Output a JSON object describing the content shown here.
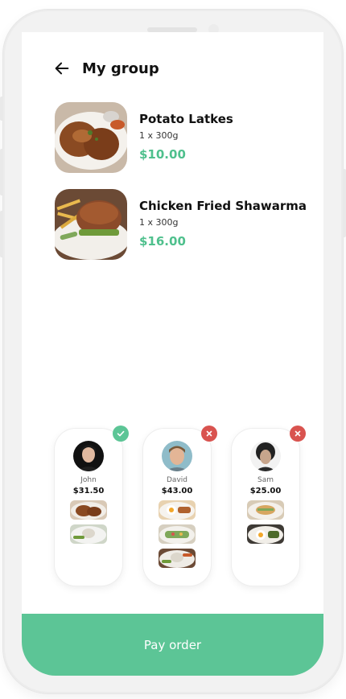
{
  "header": {
    "title": "My group"
  },
  "cart_items": [
    {
      "name": "Potato Latkes",
      "quantity": "1 x 300g",
      "price": "$10.00"
    },
    {
      "name": "Chicken Fried Shawarma",
      "quantity": "1 x 300g",
      "price": "$16.00"
    }
  ],
  "members": [
    {
      "name": "John",
      "total": "$31.50",
      "status": "paid"
    },
    {
      "name": "David",
      "total": "$43.00",
      "status": "unpaid"
    },
    {
      "name": "Sam",
      "total": "$25.00",
      "status": "unpaid"
    }
  ],
  "pay_button": {
    "label": "Pay order"
  },
  "colors": {
    "accent": "#5cc596",
    "price": "#4fc08d",
    "declined": "#d9534f",
    "approved": "#5cc596"
  },
  "icons": {
    "back": "arrow-left-icon",
    "approved": "check-icon",
    "declined": "close-icon"
  }
}
